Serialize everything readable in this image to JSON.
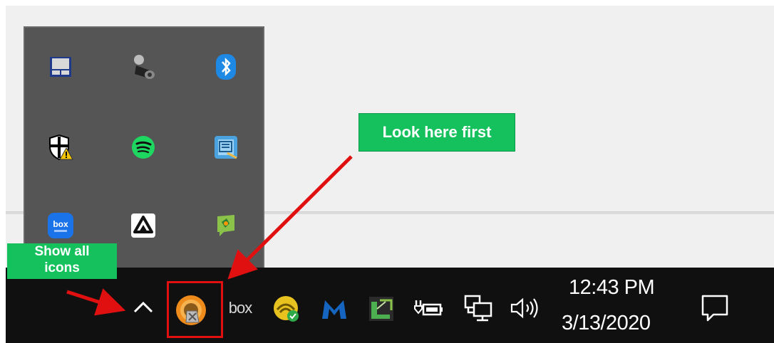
{
  "callouts": {
    "look_here": "Look here first",
    "show_all": "Show all icons"
  },
  "hidden_icons": [
    {
      "name": "touchpad-icon"
    },
    {
      "name": "speaker-device-icon"
    },
    {
      "name": "bluetooth-icon"
    },
    {
      "name": "windows-security-warning-icon"
    },
    {
      "name": "spotify-icon"
    },
    {
      "name": "app-blue-icon"
    },
    {
      "name": "box-edit-icon",
      "text": "box"
    },
    {
      "name": "google-drive-icon"
    },
    {
      "name": "green-map-icon"
    }
  ],
  "taskbar": {
    "box_label": "box",
    "clock_time": "12:43 PM",
    "clock_date": "3/13/2020"
  },
  "colors": {
    "callout_green": "#15c15d",
    "highlight_red": "#e01010",
    "taskbar_bg": "#101010",
    "popup_bg": "#555555"
  }
}
